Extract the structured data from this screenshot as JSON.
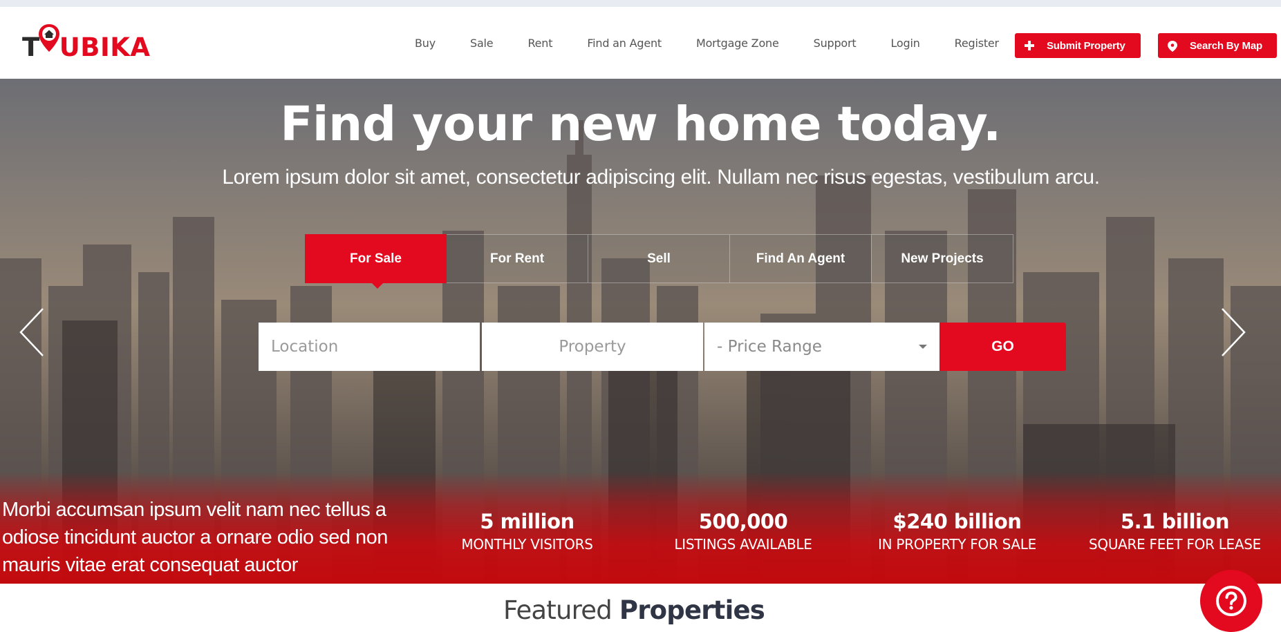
{
  "brand": {
    "logo_first": "T",
    "logo_rest": "UBIKA",
    "accent": "#e3091e"
  },
  "nav": {
    "items": [
      "Buy",
      "Sale",
      "Rent",
      "Find an Agent",
      "Mortgage Zone",
      "Support",
      "Login",
      "Register"
    ],
    "submit_label": "Submit Property",
    "map_label": "Search By Map"
  },
  "hero": {
    "title": "Find your new home today.",
    "subtitle": "Lorem ipsum dolor sit amet, consectetur adipiscing elit. Nullam nec risus egestas, vestibulum arcu."
  },
  "tabs": {
    "items": [
      "For Sale",
      "For Rent",
      "Sell",
      "Find An Agent",
      "New Projects"
    ],
    "active": "For Sale"
  },
  "search": {
    "location_placeholder": "Location",
    "property_placeholder": "Property",
    "price_selected": "- Price Range",
    "go_label": "GO"
  },
  "stats": {
    "blurb": "Morbi accumsan ipsum velit nam nec tellus a odiose tincidunt auctor a ornare odio sed non mauris vitae erat consequat auctor",
    "items": [
      {
        "value": "5 million",
        "label": "MONTHLY VISITORS"
      },
      {
        "value": "500,000",
        "label": "LISTINGS AVAILABLE"
      },
      {
        "value": "$240 billion",
        "label": "IN PROPERTY FOR SALE"
      },
      {
        "value": "5.1 billion",
        "label": "SQUARE FEET FOR LEASE"
      }
    ]
  },
  "featured": {
    "light": "Featured",
    "bold": "Properties"
  },
  "icons": {
    "slider_prev": "chevron-left-icon",
    "slider_next": "chevron-right-icon",
    "help": "question-icon",
    "submit": "plus-icon",
    "map": "map-pin-icon"
  }
}
